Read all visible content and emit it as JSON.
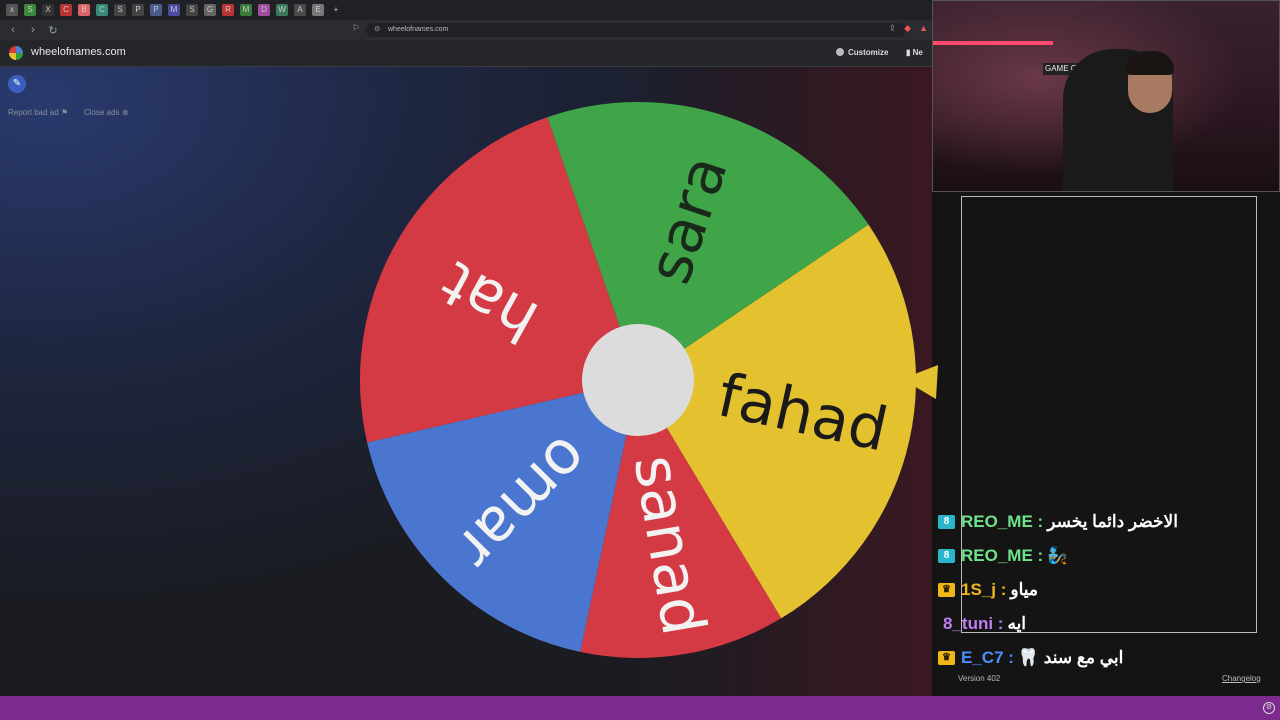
{
  "browser": {
    "tabs": [
      "x",
      "S",
      "X",
      "C",
      "B",
      "C",
      "S",
      "P",
      "P",
      "M",
      "S",
      "G",
      "R",
      "M",
      "D",
      "W",
      "A",
      "E",
      "+"
    ],
    "back_icon": "chevron-left-icon",
    "forward_icon": "chevron-right-icon",
    "reload_icon": "reload-icon",
    "url": "wheelofnames.com"
  },
  "site": {
    "name": "wheelofnames.com",
    "customize_label": "Customize",
    "new_label": "Ne",
    "edit_icon": "pencil-icon",
    "report_ad": "Report bad ad",
    "close_ads": "Close ads"
  },
  "wheel": {
    "entries": [
      {
        "name": "fahad",
        "color": "#e3c12f"
      },
      {
        "name": "sanad",
        "color": "#d43a44"
      },
      {
        "name": "omar",
        "color": "#4a76cf"
      },
      {
        "name": "hat",
        "color": "#d43a44"
      },
      {
        "name": "sara",
        "color": "#3fa548"
      }
    ],
    "hub_color": "#dcdcdc",
    "pointer_color": "#e3c12f"
  },
  "chat": {
    "messages": [
      {
        "badge": "a",
        "badge_icon": "8",
        "user": "REO_ME",
        "user_color": "#6fe38a",
        "text": "الاخضر دائما يخسر"
      },
      {
        "badge": "a",
        "badge_icon": "8",
        "user": "REO_ME",
        "user_color": "#6fe38a",
        "text": "🧞"
      },
      {
        "badge": "c",
        "badge_icon": "♛",
        "user": "1S_j",
        "user_color": "#f0b71b",
        "text": "مياو"
      },
      {
        "badge": "none",
        "badge_icon": "",
        "user": "8_tuni",
        "user_color": "#c07ff0",
        "text": "ايه"
      },
      {
        "badge": "c",
        "badge_icon": "♛",
        "user": "E_C7",
        "user_color": "#4a8dff",
        "text": "ابي مع سند 🦷"
      }
    ],
    "version": "Version 402",
    "changelog": "Changelog"
  },
  "webcam": {
    "sign_text": "GAME OVER"
  }
}
